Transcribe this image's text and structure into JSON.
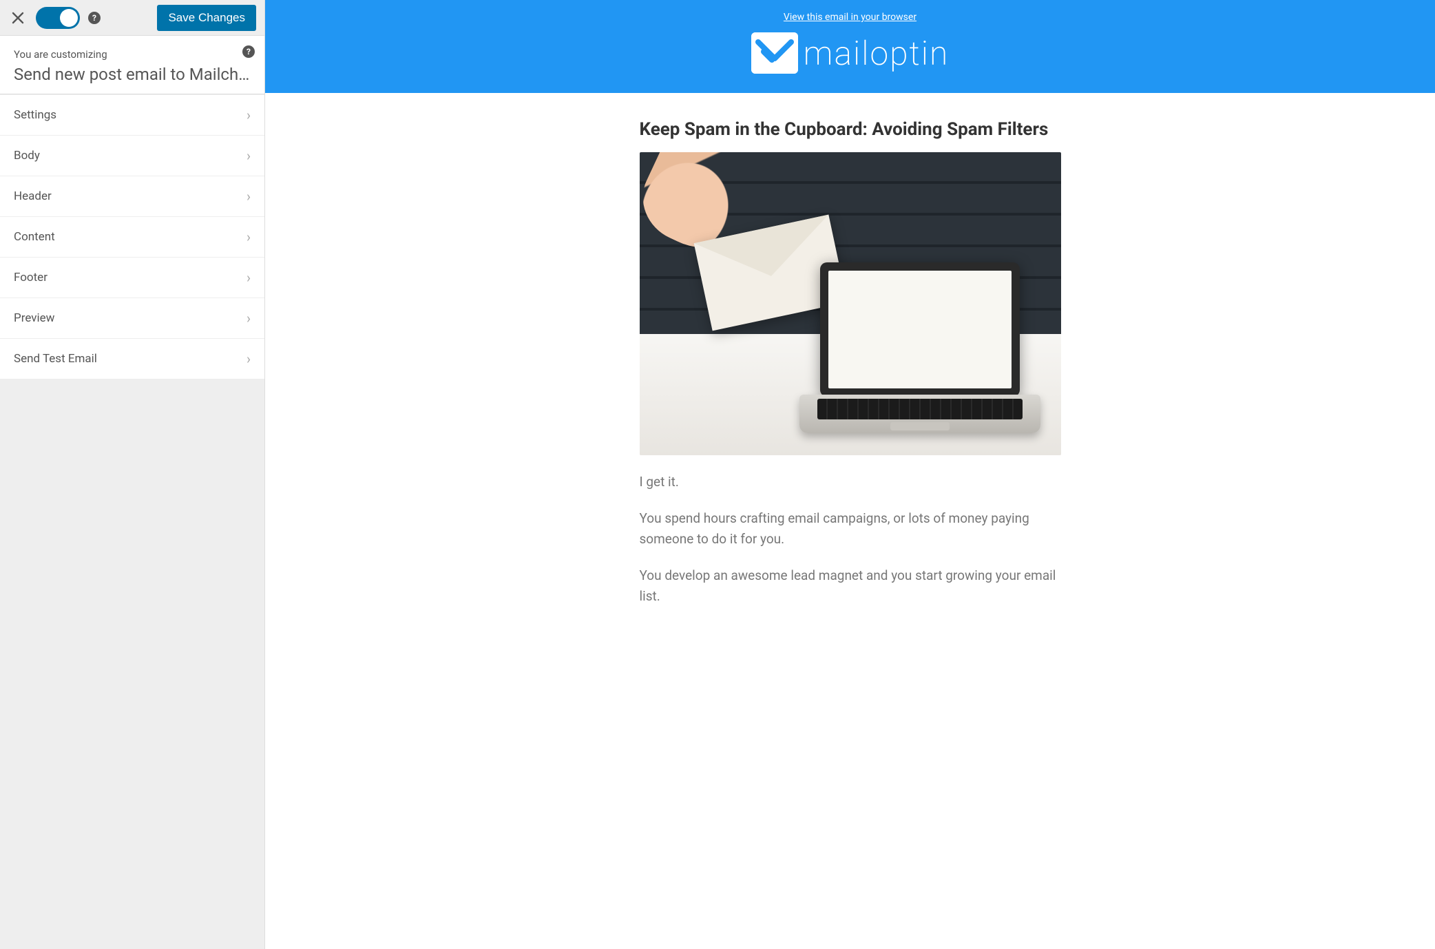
{
  "sidebar": {
    "save_label": "Save Changes",
    "customizing_label": "You are customizing",
    "title": "Send new post email to Mailchi…",
    "items": [
      {
        "label": "Settings"
      },
      {
        "label": "Body"
      },
      {
        "label": "Header"
      },
      {
        "label": "Content"
      },
      {
        "label": "Footer"
      },
      {
        "label": "Preview"
      },
      {
        "label": "Send Test Email"
      }
    ]
  },
  "preview": {
    "view_in_browser": "View this email in your browser",
    "brand": "mailoptin",
    "article_title": "Keep Spam in the Cupboard: Avoiding Spam Filters",
    "paragraphs": [
      "I get it.",
      "You spend hours crafting email campaigns, or lots of money paying someone to do it for you.",
      "You develop an awesome lead magnet and you start growing your email list."
    ]
  },
  "colors": {
    "accent": "#0073aa",
    "header_bg": "#2196f3"
  }
}
